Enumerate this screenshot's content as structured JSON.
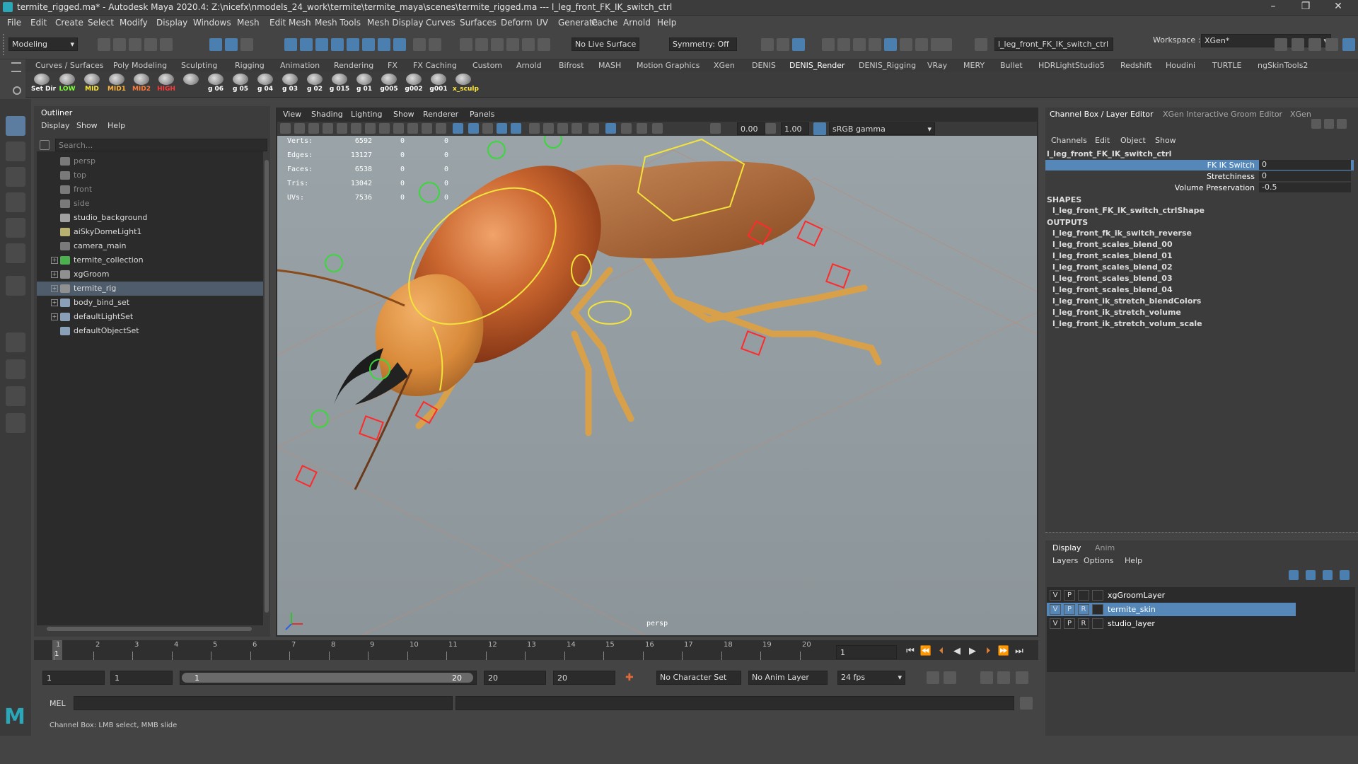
{
  "window": {
    "title": "termite_rigged.ma* - Autodesk Maya 2020.4: Z:\\nicefx\\nmodels_24_work\\termite\\termite_maya\\scenes\\termite_rigged.ma  ---  l_leg_front_FK_IK_switch_ctrl",
    "controls": [
      "–",
      "❐",
      "✕"
    ]
  },
  "menubar": [
    "File",
    "Edit",
    "Create",
    "Select",
    "Modify",
    "Display",
    "Windows",
    "Mesh",
    "Edit Mesh",
    "Mesh Tools",
    "Mesh Display",
    "Curves",
    "Surfaces",
    "Deform",
    "UV",
    "Generate",
    "Cache",
    "Arnold",
    "Help"
  ],
  "workspace": {
    "label": "Workspace :",
    "value": "XGen*"
  },
  "statusline": {
    "mode": "Modeling",
    "live_surface": "No Live Surface",
    "symmetry": "Symmetry: Off",
    "selected_field": "l_leg_front_FK_IK_switch_ctrl"
  },
  "shelf_tabs": [
    "Curves / Surfaces",
    "Poly Modeling",
    "Sculpting",
    "Rigging",
    "Animation",
    "Rendering",
    "FX",
    "FX Caching",
    "Custom",
    "Arnold",
    "Bifrost",
    "MASH",
    "Motion Graphics",
    "XGen",
    "DENIS",
    "DENIS_Render",
    "DENIS_Rigging",
    "VRay",
    "MERY",
    "Bullet",
    "HDRLightStudio5",
    "Redshift",
    "Houdini",
    "TURTLE",
    "ngSkinTools2"
  ],
  "shelf_active": "DENIS_Render",
  "shelf_items": [
    {
      "label": "Set Dir",
      "color": "#ffffff"
    },
    {
      "label": "LOW",
      "color": "#7dff3a"
    },
    {
      "label": "MID",
      "color": "#ffe83a"
    },
    {
      "label": "MID1",
      "color": "#ffb43a"
    },
    {
      "label": "MID2",
      "color": "#ff7a3a"
    },
    {
      "label": "HIGH",
      "color": "#ff3a3a"
    },
    {
      "label": "",
      "color": "#ffffff"
    },
    {
      "label": "g 06",
      "color": "#ffffff"
    },
    {
      "label": "g 05",
      "color": "#ffffff"
    },
    {
      "label": "g 04",
      "color": "#ffffff"
    },
    {
      "label": "g 03",
      "color": "#ffffff"
    },
    {
      "label": "g 02",
      "color": "#ffffff"
    },
    {
      "label": "g 015",
      "color": "#ffffff"
    },
    {
      "label": "g 01",
      "color": "#ffffff"
    },
    {
      "label": "g005",
      "color": "#ffffff"
    },
    {
      "label": "g002",
      "color": "#ffffff"
    },
    {
      "label": "g001",
      "color": "#ffffff"
    },
    {
      "label": "x_sculp",
      "color": "#ffe83a"
    }
  ],
  "outliner": {
    "title": "Outliner",
    "menu": [
      "Display",
      "Show",
      "Help"
    ],
    "search_placeholder": "Search...",
    "items": [
      {
        "label": "persp",
        "dim": true,
        "expandable": false,
        "icon": "camera-icon"
      },
      {
        "label": "top",
        "dim": true,
        "expandable": false,
        "icon": "camera-icon"
      },
      {
        "label": "front",
        "dim": true,
        "expandable": false,
        "icon": "camera-icon"
      },
      {
        "label": "side",
        "dim": true,
        "expandable": false,
        "icon": "camera-icon"
      },
      {
        "label": "studio_background",
        "dim": false,
        "expandable": false,
        "icon": "mesh-icon"
      },
      {
        "label": "aiSkyDomeLight1",
        "dim": false,
        "expandable": false,
        "icon": "light-icon"
      },
      {
        "label": "camera_main",
        "dim": false,
        "expandable": false,
        "icon": "camera-icon"
      },
      {
        "label": "termite_collection",
        "dim": false,
        "expandable": true,
        "icon": "group-icon"
      },
      {
        "label": "xgGroom",
        "dim": false,
        "expandable": true,
        "icon": "transform-icon"
      },
      {
        "label": "termite_rig",
        "dim": false,
        "expandable": true,
        "icon": "transform-icon",
        "selected": true
      },
      {
        "label": "body_bind_set",
        "dim": false,
        "expandable": true,
        "icon": "set-icon"
      },
      {
        "label": "defaultLightSet",
        "dim": false,
        "expandable": true,
        "icon": "set-icon"
      },
      {
        "label": "defaultObjectSet",
        "dim": false,
        "expandable": false,
        "icon": "set-icon"
      }
    ]
  },
  "viewport": {
    "menu": [
      "View",
      "Shading",
      "Lighting",
      "Show",
      "Renderer",
      "Panels"
    ],
    "field_a": "0.00",
    "field_b": "1.00",
    "colorspace": "sRGB gamma",
    "camera_label": "persp",
    "hud": [
      {
        "label": "Verts:",
        "v1": "6592",
        "v2": "0",
        "v3": "0"
      },
      {
        "label": "Edges:",
        "v1": "13127",
        "v2": "0",
        "v3": "0"
      },
      {
        "label": "Faces:",
        "v1": "6538",
        "v2": "0",
        "v3": "0"
      },
      {
        "label": "Tris:",
        "v1": "13042",
        "v2": "0",
        "v3": "0"
      },
      {
        "label": "UVs:",
        "v1": "7536",
        "v2": "0",
        "v3": "0"
      }
    ]
  },
  "channelbox": {
    "tabs": [
      "Channel Box / Layer Editor",
      "XGen Interactive Groom Editor",
      "XGen"
    ],
    "menu": [
      "Channels",
      "Edit",
      "Object",
      "Show"
    ],
    "object": "l_leg_front_FK_IK_switch_ctrl",
    "attributes": [
      {
        "name": "FK IK Switch",
        "value": "0",
        "highlight": true
      },
      {
        "name": "Stretchiness",
        "value": "0",
        "highlight": false
      },
      {
        "name": "Volume Preservation",
        "value": "-0.5",
        "highlight": false
      }
    ],
    "shapes_header": "SHAPES",
    "shapes": [
      "l_leg_front_FK_IK_switch_ctrlShape"
    ],
    "outputs_header": "OUTPUTS",
    "outputs": [
      "l_leg_front_fk_ik_switch_reverse",
      "l_leg_front_scales_blend_00",
      "l_leg_front_scales_blend_01",
      "l_leg_front_scales_blend_02",
      "l_leg_front_scales_blend_03",
      "l_leg_front_scales_blend_04",
      "l_leg_front_ik_stretch_blendColors",
      "l_leg_front_ik_stretch_volume",
      "l_leg_front_ik_stretch_volum_scale"
    ]
  },
  "layer_editor": {
    "tabs": [
      "Display",
      "Anim"
    ],
    "menu": [
      "Layers",
      "Options",
      "Help"
    ],
    "layers": [
      {
        "v": "V",
        "p": "P",
        "r": "",
        "name": "xgGroomLayer",
        "selected": false
      },
      {
        "v": "V",
        "p": "P",
        "r": "R",
        "name": "termite_skin",
        "selected": true
      },
      {
        "v": "V",
        "p": "P",
        "r": "R",
        "name": "studio_layer",
        "selected": false
      }
    ]
  },
  "timeline": {
    "ticks": [
      "1",
      "2",
      "3",
      "4",
      "5",
      "6",
      "7",
      "8",
      "9",
      "10",
      "11",
      "12",
      "13",
      "14",
      "15",
      "16",
      "17",
      "18",
      "19",
      "20"
    ],
    "current_frame_marker": "1",
    "current_frame_field": "1"
  },
  "range": {
    "start": "1",
    "playback_start": "1",
    "slider_start": "1",
    "slider_end": "20",
    "playback_end": "20",
    "end": "20",
    "character_set": "No Character Set",
    "anim_layer": "No Anim Layer",
    "fps": "24 fps"
  },
  "command": {
    "label": "MEL"
  },
  "helpline": "Channel Box: LMB select, MMB slide"
}
